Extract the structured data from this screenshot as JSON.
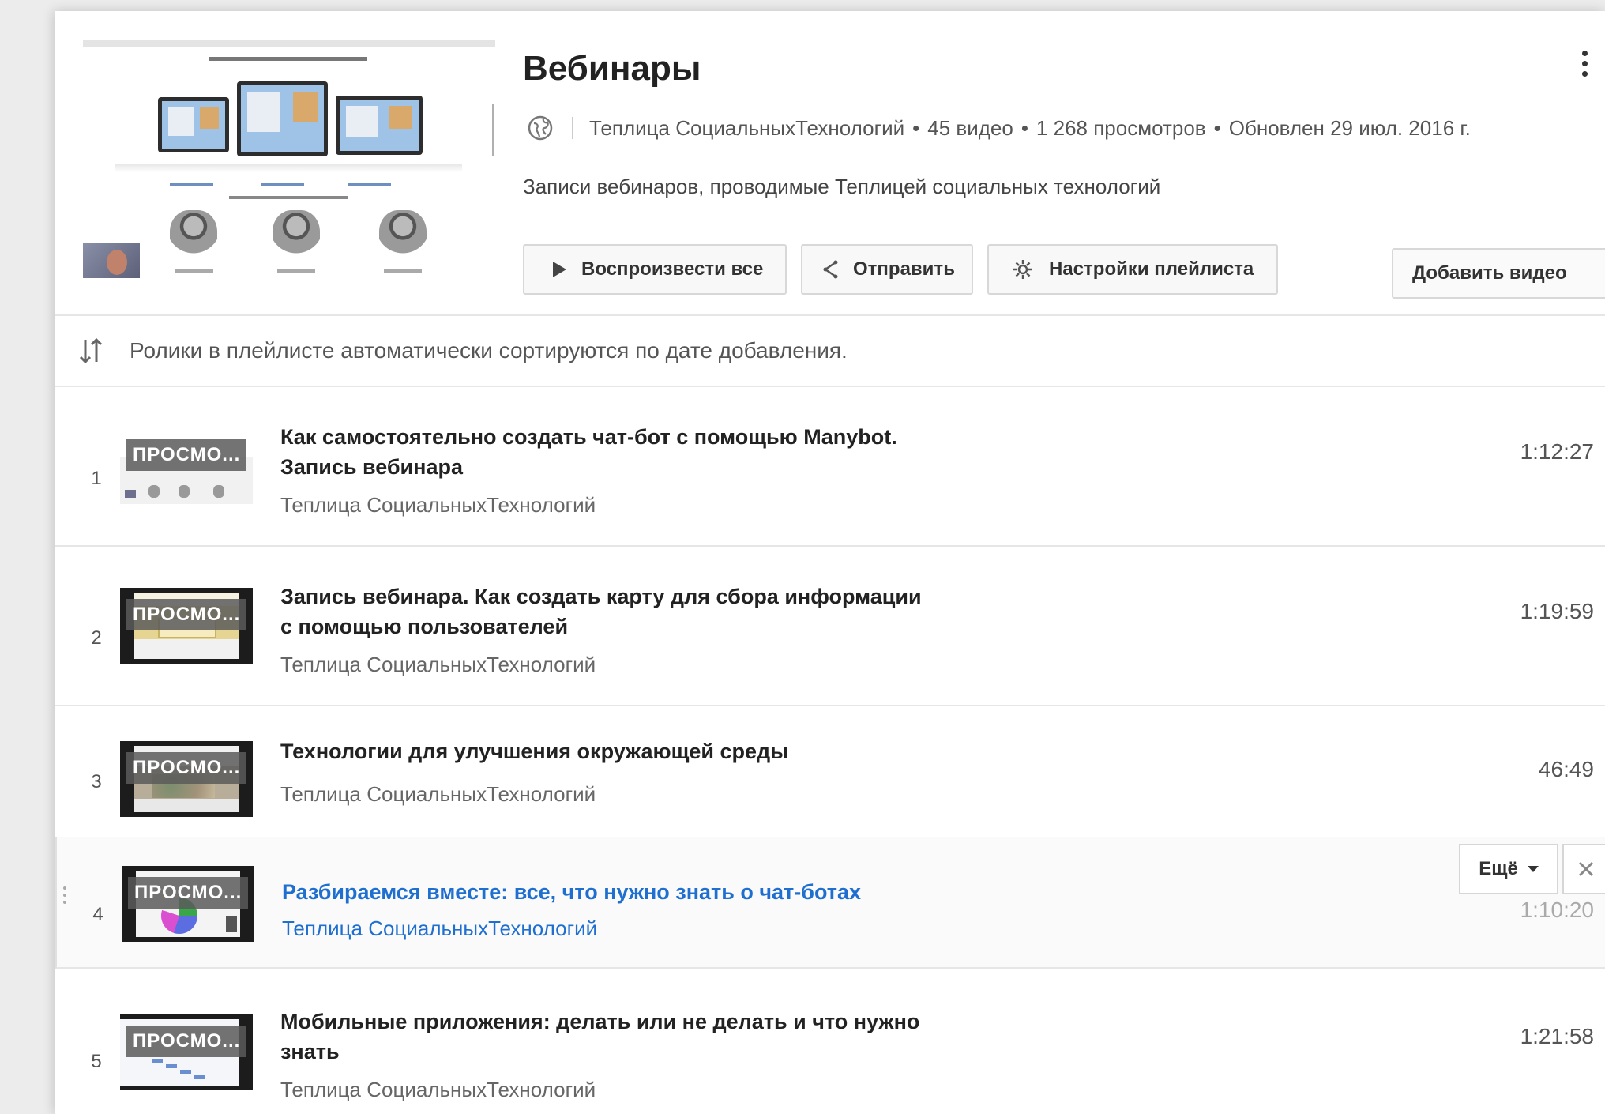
{
  "playlist": {
    "title": "Вебинары",
    "channel": "Теплица СоциальныхТехнологий",
    "video_count": "45 видео",
    "views": "1 268 просмотров",
    "updated": "Обновлен 29 июл. 2016 г.",
    "description": "Записи вебинаров, проводимые Теплицей социальных технологий",
    "privacy_icon": "globe-icon"
  },
  "actions": {
    "play_all": "Воспроизвести все",
    "share": "Отправить",
    "settings": "Настройки плейлиста",
    "add_video": "Добавить видео"
  },
  "sort_notice": "Ролики в плейлисте автоматически сортируются по дате добавления.",
  "thumbnail_badge": "ПРОСМО...",
  "row_actions": {
    "more": "Ещё"
  },
  "videos": [
    {
      "index": "1",
      "title_line1": "Как самостоятельно создать чат-бот с помощью Manybot.",
      "title_line2": "Запись вебинара",
      "channel": "Теплица СоциальныхТехнологий",
      "duration": "1:12:27"
    },
    {
      "index": "2",
      "title_line1": "Запись вебинара. Как создать карту для сбора информации",
      "title_line2": "с помощью пользователей",
      "channel": "Теплица СоциальныхТехнологий",
      "duration": "1:19:59"
    },
    {
      "index": "3",
      "title_line1": "Технологии для улучшения окружающей среды",
      "channel": "Теплица СоциальныхТехнологий",
      "duration": "46:49"
    },
    {
      "index": "4",
      "title_line1": "Разбираемся вместе: все, что нужно знать о чат-ботах",
      "channel": "Теплица СоциальныхТехнологий",
      "duration": "1:10:20"
    },
    {
      "index": "5",
      "title_line1": "Мобильные приложения: делать или не делать и что нужно",
      "title_line2": "знать",
      "channel": "Теплица СоциальныхТехнологий",
      "duration": "1:21:58"
    }
  ],
  "colors": {
    "link": "#1f6fd0",
    "text": "#222222",
    "muted": "#666666",
    "border": "#e6e6e6"
  }
}
